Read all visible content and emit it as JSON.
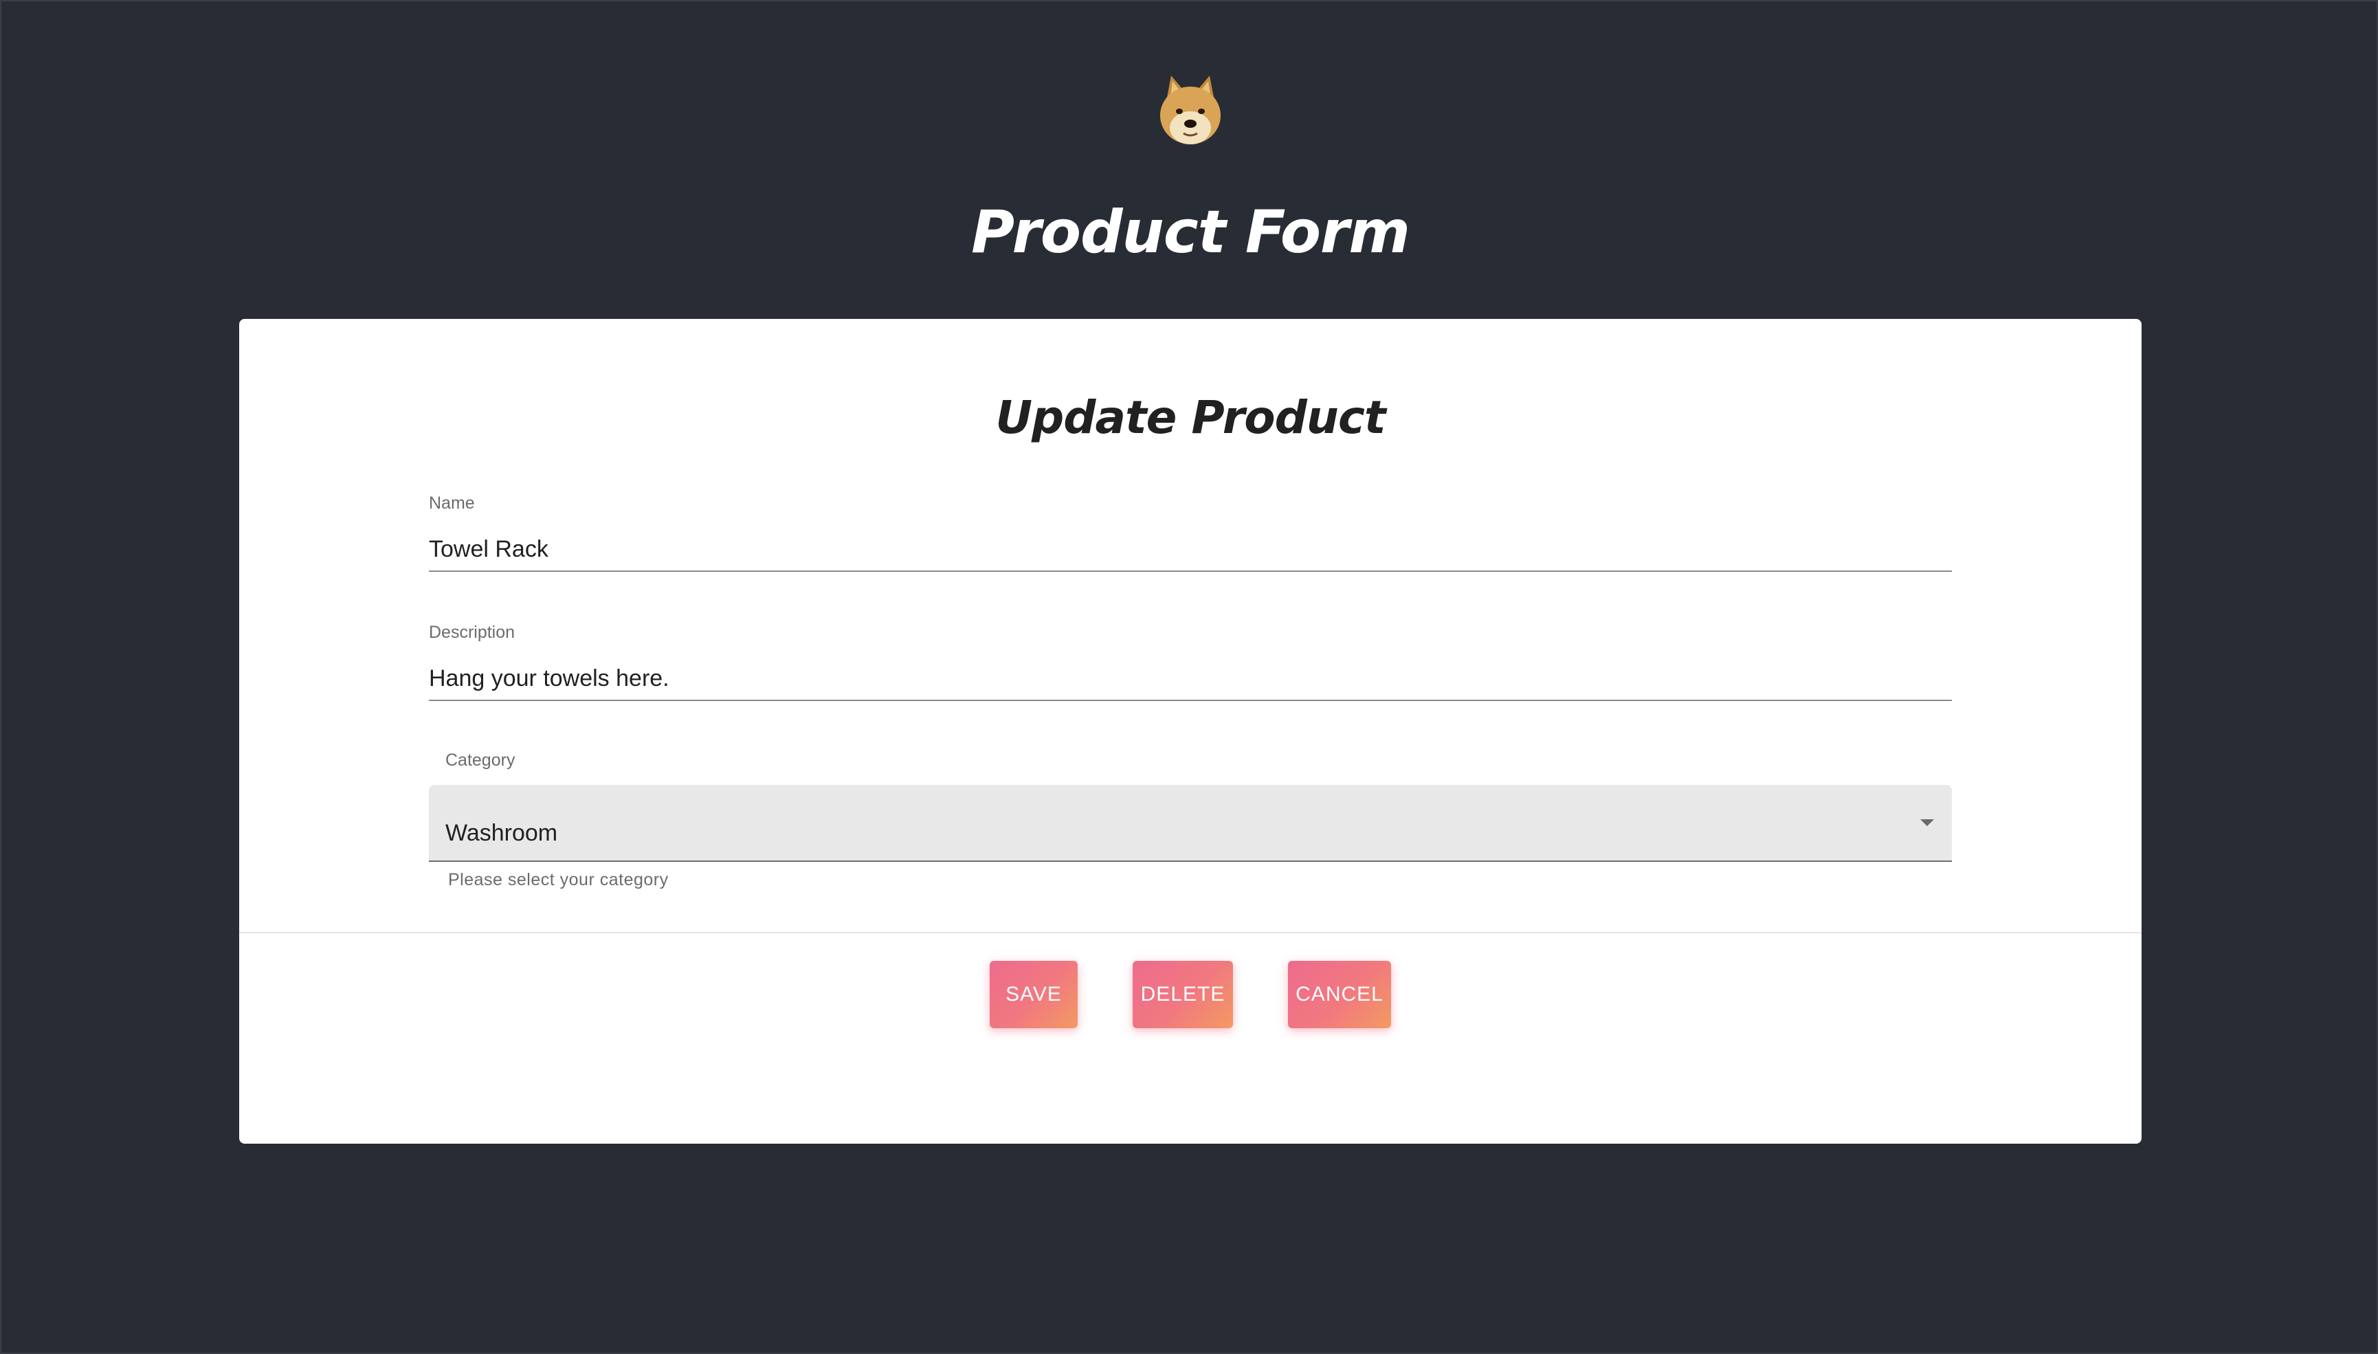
{
  "header": {
    "logo_icon": "doge-logo-icon",
    "title": "Product Form"
  },
  "form": {
    "title": "Update Product",
    "name": {
      "label": "Name",
      "value": "Towel Rack"
    },
    "description": {
      "label": "Description",
      "value": "Hang your towels here."
    },
    "category": {
      "label": "Category",
      "selected": "Washroom",
      "helper": "Please select your category",
      "icon": "dropdown-arrow-icon"
    },
    "actions": {
      "save_label": "Save",
      "delete_label": "Delete",
      "cancel_label": "Cancel"
    }
  },
  "colors": {
    "background": "#282c34",
    "card": "#ffffff",
    "button_gradient_start": "#ee6b8d",
    "button_gradient_end": "#f39a61"
  }
}
